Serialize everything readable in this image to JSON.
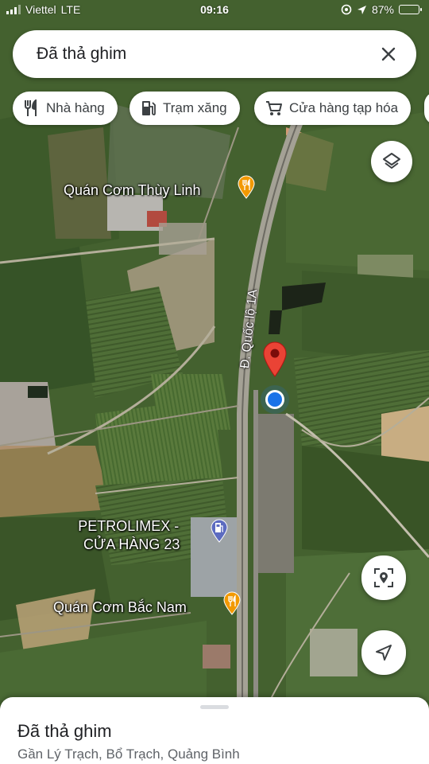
{
  "status_bar": {
    "carrier": "Viettel",
    "network": "LTE",
    "time": "09:16",
    "battery_text": "87%",
    "battery_level": 0.87
  },
  "search": {
    "query": "Đã thả ghim"
  },
  "chips": [
    {
      "label": "Nhà hàng",
      "icon": "restaurant-icon"
    },
    {
      "label": "Trạm xăng",
      "icon": "gas-station-icon"
    },
    {
      "label": "Cửa hàng tạp hóa",
      "icon": "shopping-cart-icon"
    }
  ],
  "map": {
    "labels": {
      "poi_thuy_linh": "Quán Cơm Thùy Linh",
      "road": "Đ. Quốc lộ 1A",
      "petrolimex_line1": "PETROLIMEX -",
      "petrolimex_line2": "CỬA HÀNG 23",
      "poi_bac_nam": "Quán Cơm Bắc Nam"
    },
    "colors": {
      "restaurant_pin": "#f29900",
      "gas_pin": "#5c6bc0",
      "dropped_pin": "#ea4335",
      "location_dot": "#1a73e8"
    }
  },
  "controls": {
    "layers_icon": "layers-icon",
    "location_pin_icon": "place-target-icon",
    "navigate_icon": "navigation-arrow-icon"
  },
  "sheet": {
    "title": "Đã thả ghim",
    "subtitle": "Gần Lý Trạch, Bổ Trạch, Quảng Bình"
  }
}
